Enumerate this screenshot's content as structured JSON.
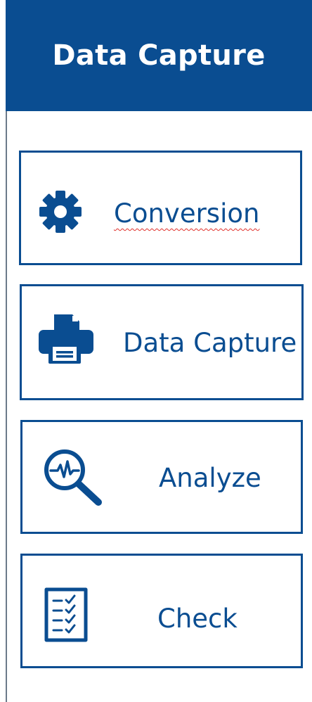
{
  "header": {
    "title": "Data Capture"
  },
  "nav": {
    "items": [
      {
        "label": "Conversion",
        "icon": "gear-icon"
      },
      {
        "label": "Data Capture",
        "icon": "printer-icon"
      },
      {
        "label": "Analyze",
        "icon": "magnifier-pulse-icon"
      },
      {
        "label": "Check",
        "icon": "checklist-icon"
      }
    ]
  },
  "colors": {
    "brand_blue": "#0a4d91",
    "background": "#ffffff",
    "spellcheck_underline": "#e0302b"
  }
}
